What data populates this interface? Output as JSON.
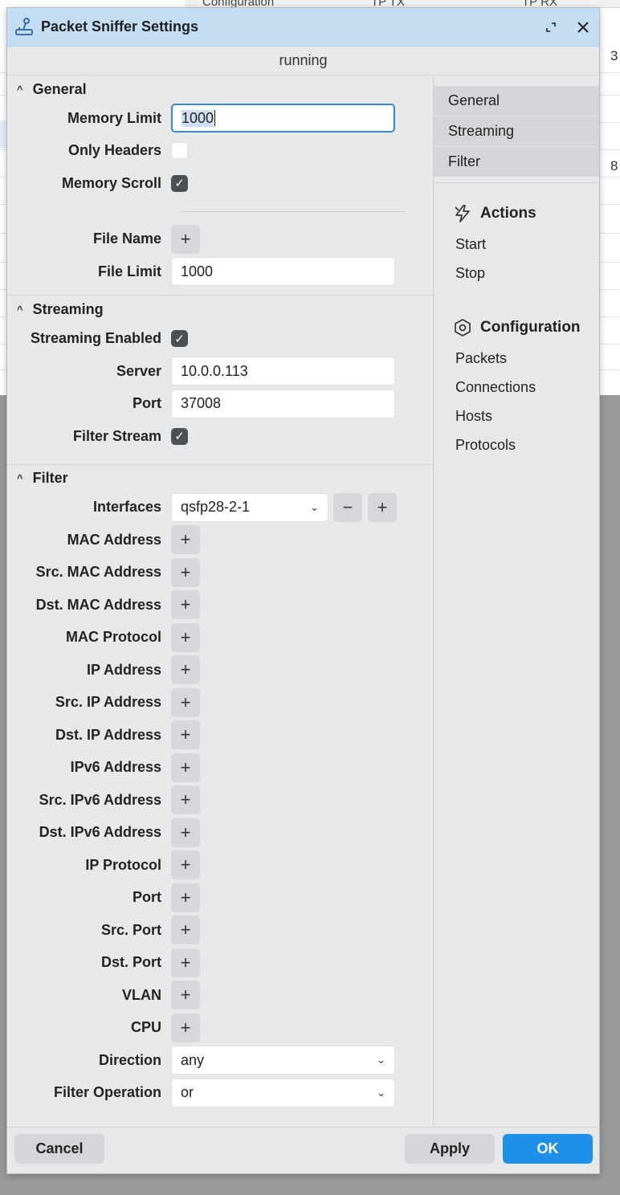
{
  "background": {
    "header_cols": [
      "Configuration",
      "TP TX",
      "TP RX"
    ],
    "side_values": [
      "3",
      "8"
    ]
  },
  "dialog": {
    "title": "Packet Sniffer Settings",
    "status": "running"
  },
  "general": {
    "heading": "General",
    "memory_limit_label": "Memory Limit",
    "memory_limit_value": "1000",
    "only_headers_label": "Only Headers",
    "only_headers_checked": false,
    "memory_scroll_label": "Memory Scroll",
    "memory_scroll_checked": true,
    "file_name_label": "File Name",
    "file_limit_label": "File Limit",
    "file_limit_value": "1000"
  },
  "streaming": {
    "heading": "Streaming",
    "enabled_label": "Streaming Enabled",
    "enabled_checked": true,
    "server_label": "Server",
    "server_value": "10.0.0.113",
    "port_label": "Port",
    "port_value": "37008",
    "filter_stream_label": "Filter Stream",
    "filter_stream_checked": true
  },
  "filter": {
    "heading": "Filter",
    "interfaces_label": "Interfaces",
    "interfaces_value": "qsfp28-2-1",
    "add_rows": [
      "MAC Address",
      "Src. MAC Address",
      "Dst. MAC Address",
      "MAC Protocol",
      "IP Address",
      "Src. IP Address",
      "Dst. IP Address",
      "IPv6 Address",
      "Src. IPv6 Address",
      "Dst. IPv6 Address",
      "IP Protocol",
      "Port",
      "Src. Port",
      "Dst. Port",
      "VLAN",
      "CPU"
    ],
    "direction_label": "Direction",
    "direction_value": "any",
    "operation_label": "Filter Operation",
    "operation_value": "or"
  },
  "side_nav": {
    "tabs": [
      "General",
      "Streaming",
      "Filter"
    ],
    "actions_heading": "Actions",
    "actions": [
      "Start",
      "Stop"
    ],
    "config_heading": "Configuration",
    "config_links": [
      "Packets",
      "Connections",
      "Hosts",
      "Protocols"
    ]
  },
  "footer": {
    "cancel_label": "Cancel",
    "apply_label": "Apply",
    "ok_label": "OK"
  },
  "colors": {
    "titlebar": "#c3ddf2",
    "primary": "#1e90e8",
    "focus": "#3a86d1"
  }
}
